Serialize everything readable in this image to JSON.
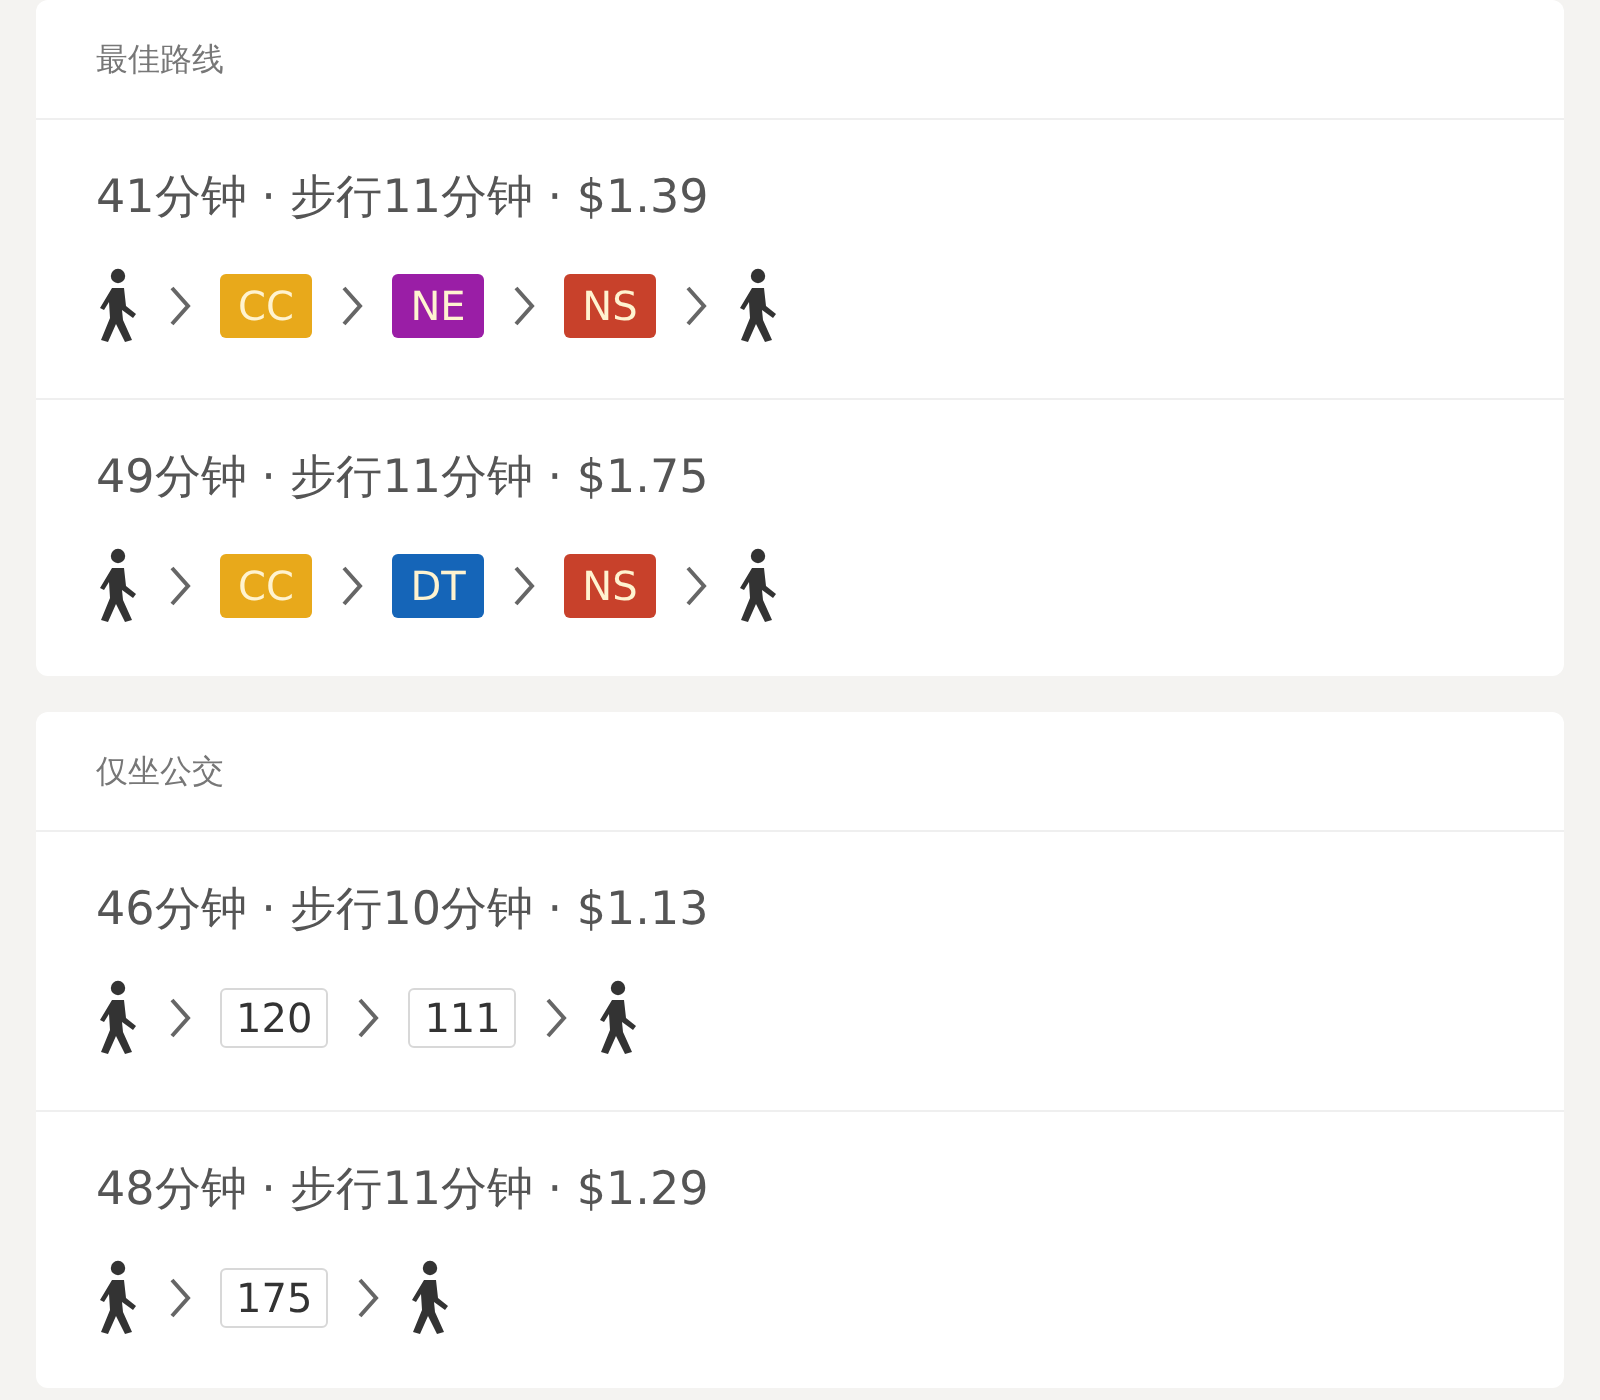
{
  "sections": [
    {
      "title": "最佳路线",
      "routes": [
        {
          "summary": "41分钟 · 步行11分钟 · $1.39",
          "steps": [
            {
              "kind": "walk"
            },
            {
              "kind": "rail",
              "label": "CC",
              "color": "#e8a91b"
            },
            {
              "kind": "rail",
              "label": "NE",
              "color": "#9a1ea6"
            },
            {
              "kind": "rail",
              "label": "NS",
              "color": "#c8412b"
            },
            {
              "kind": "walk"
            }
          ]
        },
        {
          "summary": "49分钟 · 步行11分钟 · $1.75",
          "steps": [
            {
              "kind": "walk"
            },
            {
              "kind": "rail",
              "label": "CC",
              "color": "#e8a91b"
            },
            {
              "kind": "rail",
              "label": "DT",
              "color": "#1565b8"
            },
            {
              "kind": "rail",
              "label": "NS",
              "color": "#c8412b"
            },
            {
              "kind": "walk"
            }
          ]
        }
      ]
    },
    {
      "title": "仅坐公交",
      "routes": [
        {
          "summary": "46分钟 · 步行10分钟 · $1.13",
          "steps": [
            {
              "kind": "walk"
            },
            {
              "kind": "bus",
              "label": "120"
            },
            {
              "kind": "bus",
              "label": "111"
            },
            {
              "kind": "walk"
            }
          ]
        },
        {
          "summary": "48分钟 · 步行11分钟 · $1.29",
          "steps": [
            {
              "kind": "walk"
            },
            {
              "kind": "bus",
              "label": "175"
            },
            {
              "kind": "walk"
            }
          ]
        }
      ]
    }
  ]
}
